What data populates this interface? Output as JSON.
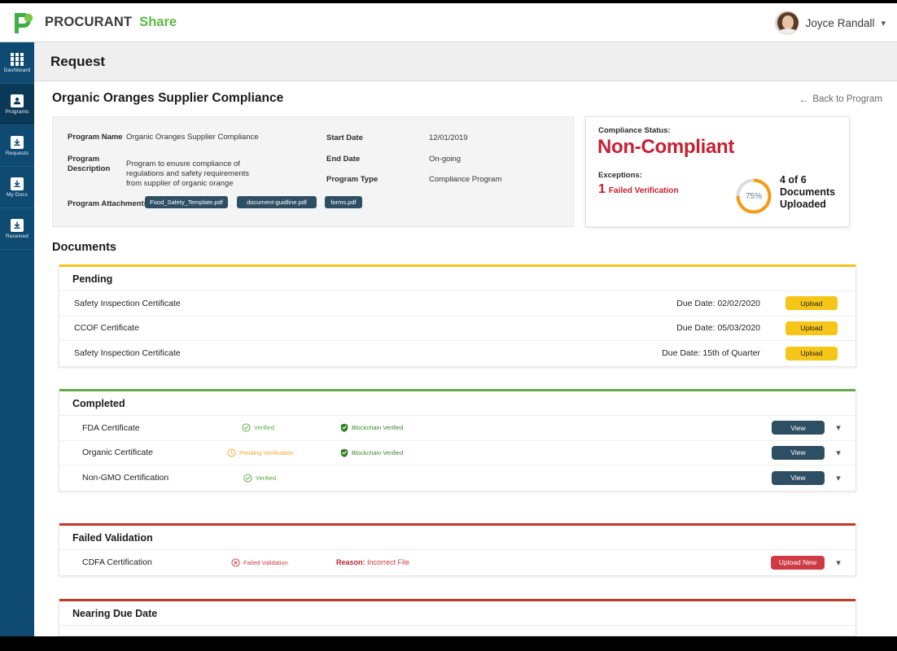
{
  "brand": {
    "logo_icon": "procurant-p-logo",
    "name": "PROCURANT",
    "sub": "Share",
    "green": "#5cb946"
  },
  "user": {
    "name": "Joyce Randall",
    "caret_icon": "chevron-down-icon",
    "avatar_icon": "user-avatar"
  },
  "sidebar": {
    "items": [
      {
        "label": "Dashboard",
        "icon": "grid-icon",
        "active": false
      },
      {
        "label": "Programs",
        "icon": "programs-icon",
        "active": true
      },
      {
        "label": "Requests",
        "icon": "download-box-icon",
        "active": false
      },
      {
        "label": "My Docs",
        "icon": "download-box-icon",
        "active": false
      },
      {
        "label": "Received",
        "icon": "download-box-icon",
        "active": false
      }
    ]
  },
  "header": {
    "title": "Request"
  },
  "program": {
    "title": "Organic Oranges Supplier Compliance",
    "back_link": "Back to Program",
    "back_icon": "arrow-left-icon",
    "fields": {
      "program_name_label": "Program Name",
      "program_name_value": "Organic Oranges Supplier Compliance",
      "description_label_line1": "Program",
      "description_label_line2": "Description",
      "description_value_line1": "Program to enusre compliance of",
      "description_value_line2": "regulations and safety requirements",
      "description_value_line3": "from supplier of organic orange",
      "start_date_label": "Start Date",
      "start_date_value": "12/01/2019",
      "end_date_label": "End Date",
      "end_date_value": "On-going",
      "program_type_label": "Program Type",
      "program_type_value": "Compliance Program",
      "attachments_label": "Program Attachments"
    },
    "attachments": [
      "Food_Safety_Template.pdf",
      "document-guidline.pdf",
      "forms.pdf"
    ]
  },
  "compliance": {
    "status_label": "Compliance Status:",
    "status_value": "Non-Compliant",
    "status_color": "#c62032",
    "exceptions_label": "Exceptions:",
    "exception_count": "1",
    "exception_text": "Failed Verification",
    "progress_percent_label": "75%",
    "progress_percent": 75,
    "progress_color": "#f59a11",
    "progress_track_color": "#dcdcdc",
    "docs_line1": "4 of 6",
    "docs_line2": "Documents",
    "docs_line3": "Uploaded"
  },
  "documents": {
    "heading": "Documents",
    "groups": [
      {
        "title": "Pending",
        "accent": "#f5c518",
        "rows": [
          {
            "name": "Safety Inspection Certificate",
            "due": "Due Date: 02/02/2020",
            "action": "Upload",
            "action_type": "upload"
          },
          {
            "name": "CCOF Certificate",
            "due": "Due Date: 05/03/2020",
            "action": "Upload",
            "action_type": "upload"
          },
          {
            "name": "Safety Inspection Certificate",
            "due": "Due Date: 15th of Quarter",
            "action": "Upload",
            "action_type": "upload"
          }
        ]
      },
      {
        "title": "Completed",
        "accent": "#6aa84f",
        "rows": [
          {
            "name": "FDA Certificate",
            "status": "Verified",
            "status_type": "verified",
            "chain": "Blockchain Verified",
            "action": "View",
            "action_type": "view",
            "chevron": "chevron-down-icon"
          },
          {
            "name": "Organic Certificate",
            "status": "Pending Verification",
            "status_type": "pending",
            "chain": "Blockchain Verified",
            "action": "View",
            "action_type": "view",
            "chevron": "chevron-down-icon"
          },
          {
            "name": "Non-GMO Certification",
            "status": "Verified",
            "status_type": "verified",
            "chain": "",
            "action": "View",
            "action_type": "view",
            "chevron": "chevron-down-icon"
          }
        ]
      },
      {
        "title": "Failed Validation",
        "accent": "#c0392b",
        "rows": [
          {
            "name": "CDFA Certification",
            "status": "Failed Validation",
            "status_type": "failed",
            "reason_label": "Reason:",
            "reason_value": "Incorrect File",
            "action": "Upload New",
            "action_type": "upload-new",
            "chevron": "chevron-down-icon"
          }
        ]
      },
      {
        "title": "Nearing Due Date",
        "accent": "#c0392b",
        "rows": []
      }
    ]
  }
}
